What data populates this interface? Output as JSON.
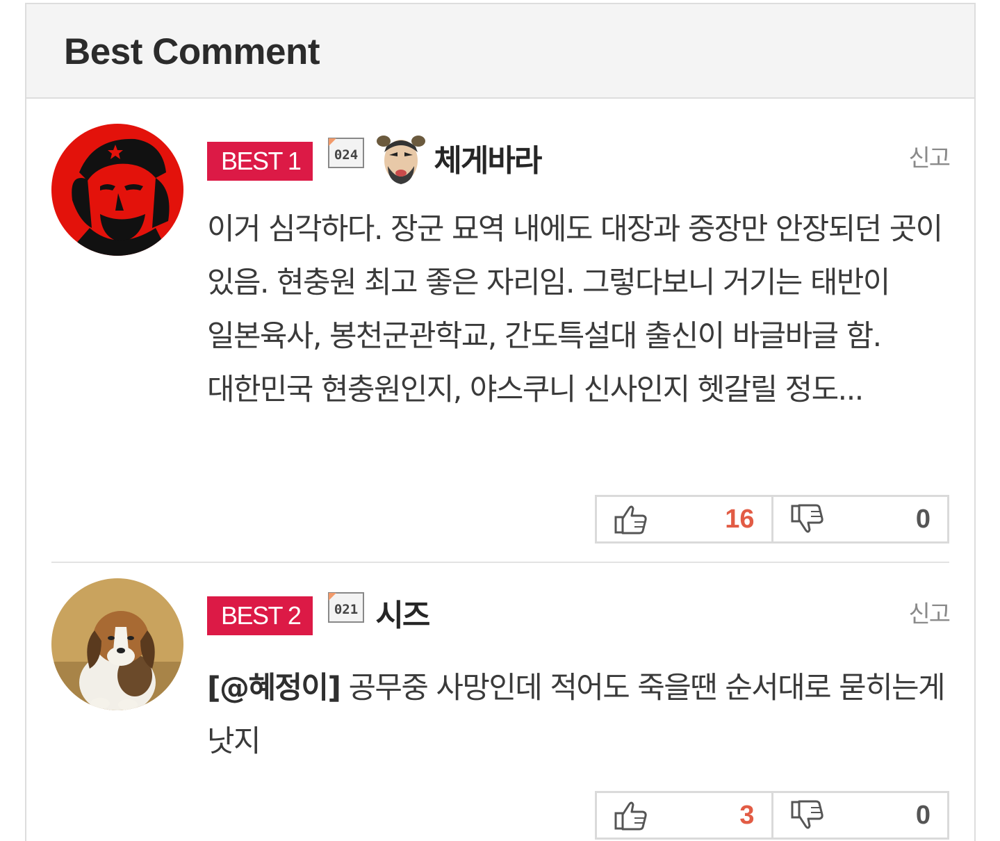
{
  "header": {
    "title": "Best Comment"
  },
  "comments": [
    {
      "badge": "BEST 1",
      "level": "024",
      "nickname": "체게바라",
      "has_user_icon": true,
      "report_label": "신고",
      "mention": "",
      "text": "이거 심각하다. 장군 묘역 내에도 대장과 중장만 안장되던 곳이 있음. 현충원 최고 좋은 자리임. 그렇다보니 거기는 태반이 일본육사, 봉천군관학교, 간도특설대 출신이 바글바글 함. 대한민국 현충원인지, 야스쿠니 신사인지 헷갈릴 정도...",
      "avatar": "red-portrait-avatar",
      "upvotes": "16",
      "downvotes": "0"
    },
    {
      "badge": "BEST 2",
      "level": "021",
      "nickname": "시즈",
      "has_user_icon": false,
      "report_label": "신고",
      "mention": "[@혜정이]",
      "text": " 공무중 사망인데 적어도 죽을땐 순서대로 묻히는게 낫지",
      "avatar": "puppy-avatar",
      "upvotes": "3",
      "downvotes": "0"
    }
  ],
  "icons": {
    "thumbs_up": "thumbs-up-icon",
    "thumbs_down": "thumbs-down-icon"
  },
  "colors": {
    "badge": "#dc1a46",
    "upvote": "#e25c45",
    "header_bg": "#f4f4f4"
  }
}
